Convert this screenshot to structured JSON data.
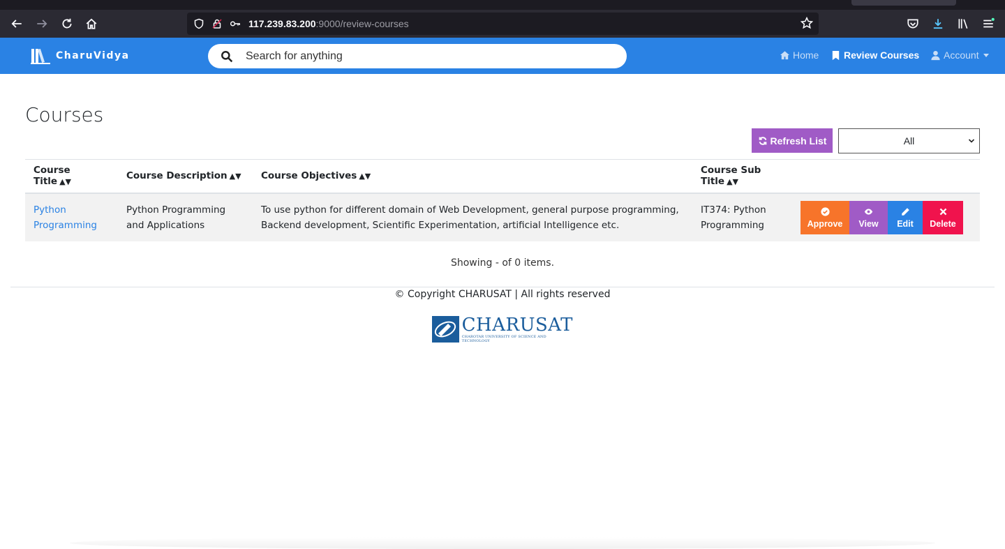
{
  "browser": {
    "url_host": "117.239.83.200",
    "url_rest": ":9000/review-courses",
    "icons": [
      "back-icon",
      "forward-icon",
      "reload-icon",
      "home-icon",
      "shield-icon",
      "lock-icon",
      "key-icon",
      "star-icon",
      "pocket-icon",
      "download-icon",
      "library-icon",
      "menu-icon"
    ]
  },
  "navbar": {
    "brand": "CharuVidya",
    "search_placeholder": "Search for anything",
    "home_label": "Home",
    "review_label": "Review Courses",
    "account_label": "Account",
    "color": "#2a82e4"
  },
  "main": {
    "title": "Courses",
    "refresh_label": "Refresh List",
    "filter_value": "All"
  },
  "table": {
    "headers": [
      "Course Title",
      "Course Description",
      "Course Objectives",
      "Course Sub Title"
    ],
    "rows": [
      {
        "title": "Python Programming",
        "description": "Python Programming and Applications",
        "objectives": "To use python for different domain of Web Development, general purpose programming, Backend development, Scientific Experimentation, artificial Intelligence etc.",
        "subtitle": "IT374: Python Programming",
        "actions": {
          "approve": "Approve",
          "view": "View",
          "edit": "Edit",
          "delete": "Delete"
        }
      }
    ]
  },
  "showing_text": "Showing - of 0 items.",
  "footer": {
    "copyright": "© Copyright CHARUSAT | All rights reserved",
    "logo_name": "CHARUSAT",
    "logo_sub": "CHAROTAR UNIVERSITY OF SCIENCE AND TECHNOLOGY"
  },
  "colors": {
    "approve": "#f7742a",
    "view": "#a05bc6",
    "edit": "#2a82e4",
    "delete": "#f0134d"
  }
}
